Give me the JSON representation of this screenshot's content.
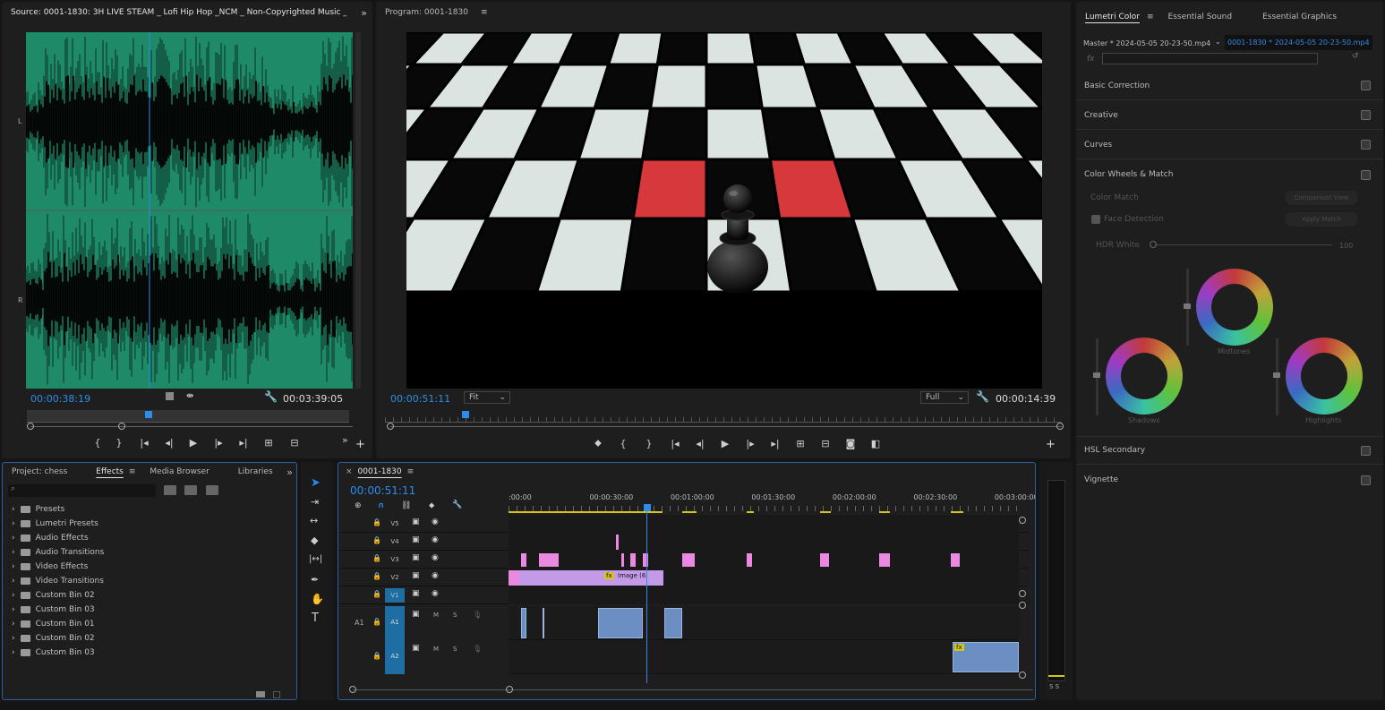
{
  "source": {
    "title": "Source: 0001-1830: 3H LIVE STEAM _ Lofi Hip Hop _NCM _ Non-Copyrighted Music _ Relax _",
    "timecode_current": "00:00:38:19",
    "timecode_duration": "00:03:39:05",
    "channel_L": "L",
    "channel_R": "R",
    "waveform_color": "#1e8a68"
  },
  "program": {
    "title": "Program: 0001-1830",
    "timecode_current": "00:00:51:11",
    "fit_value": "Fit",
    "quality_value": "Full",
    "timecode_duration": "00:00:14:39"
  },
  "lumetri": {
    "tabs": [
      "Lumetri Color",
      "Essential Sound",
      "Essential Graphics"
    ],
    "master_label": "Master * 2024-05-05 20-23-50.mp4",
    "clip_label": "0001-1830 * 2024-05-05 20-23-50.mp4",
    "fx_label": "fx",
    "sections": [
      "Basic Correction",
      "Creative",
      "Curves",
      "Color Wheels & Match",
      "HSL Secondary",
      "Vignette"
    ],
    "color_match": "Color Match",
    "comparison_view": "Comparison View",
    "face_detection": "Face Detection",
    "apply_match": "Apply Match",
    "hdr_white": "HDR White",
    "hdr_value": "100",
    "wheels": [
      "Shadows",
      "Midtones",
      "Highlights"
    ]
  },
  "project": {
    "tabs": [
      "Project: chess",
      "Effects",
      "Media Browser",
      "Libraries"
    ],
    "items": [
      "Presets",
      "Lumetri Presets",
      "Audio Effects",
      "Audio Transitions",
      "Video Effects",
      "Video Transitions",
      "Custom Bin 02",
      "Custom Bin 03",
      "Custom Bin 01",
      "Custom Bin 02",
      "Custom Bin 03"
    ]
  },
  "timeline": {
    "title": "0001-1830",
    "timecode": "00:00:51:11",
    "ruler": [
      ":00:00",
      "00:00:30:00",
      "00:01:00:00",
      "00:01:30:00",
      "00:02:00:00",
      "00:02:30:00",
      "00:03:00:00"
    ],
    "video_tracks": [
      "V5",
      "V4",
      "V3",
      "V2",
      "V1"
    ],
    "audio_tracks": [
      "A1",
      "A2"
    ],
    "audio_source_patch": "A1",
    "track_m": "M",
    "track_s": "S",
    "clip_label": "Image (6",
    "clip_fx": "fx",
    "playhead_fraction": 0.272,
    "meter_labels": "S S"
  }
}
